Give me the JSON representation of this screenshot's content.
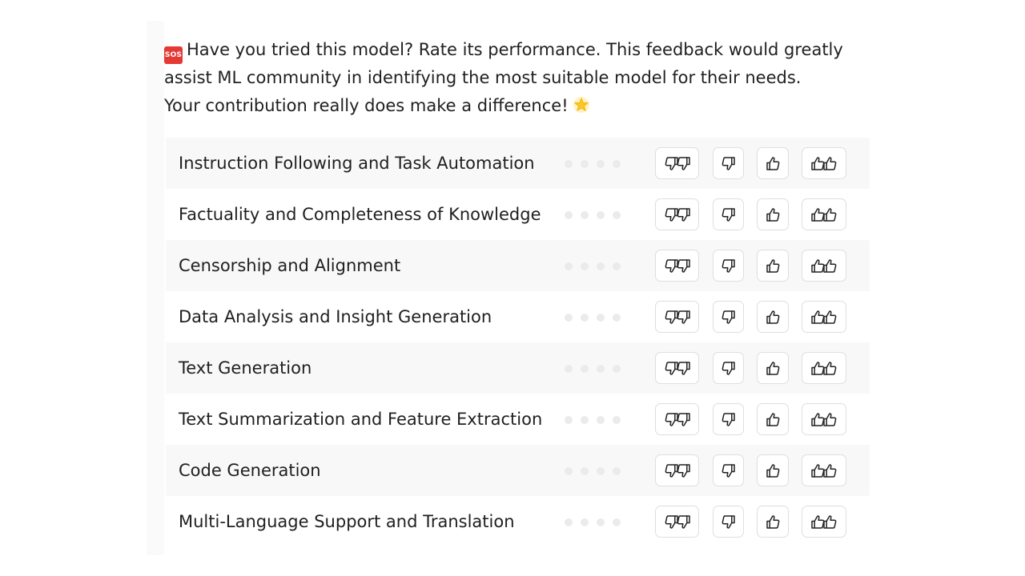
{
  "intro": {
    "sos_icon": "sos-icon",
    "line1": "Have you tried this model? Rate its performance. This feedback would greatly",
    "line2": "assist ML community in identifying the most suitable model for their needs.",
    "line3": "Your contribution really does make a difference!",
    "star_icon": "glowing-star-icon"
  },
  "categories": [
    {
      "label": "Instruction Following and Task Automation"
    },
    {
      "label": "Factuality and Completeness of Knowledge"
    },
    {
      "label": "Censorship and Alignment"
    },
    {
      "label": "Data Analysis and Insight Generation"
    },
    {
      "label": "Text Generation"
    },
    {
      "label": "Text Summarization and Feature Extraction"
    },
    {
      "label": "Code Generation"
    },
    {
      "label": "Multi-Language Support and Translation"
    }
  ],
  "rating_buttons": [
    {
      "name": "double-thumbs-down",
      "icon": "double-thumbs-down-icon"
    },
    {
      "name": "thumbs-down",
      "icon": "thumbs-down-icon"
    },
    {
      "name": "thumbs-up",
      "icon": "thumbs-up-icon"
    },
    {
      "name": "double-thumbs-up",
      "icon": "double-thumbs-up-icon"
    }
  ],
  "rating_dots_per_row": 4,
  "colors": {
    "sos_badge": "#e53935",
    "row_shade": "#f8f8f8",
    "dot": "#ebebeb",
    "button_border": "#dedede"
  }
}
